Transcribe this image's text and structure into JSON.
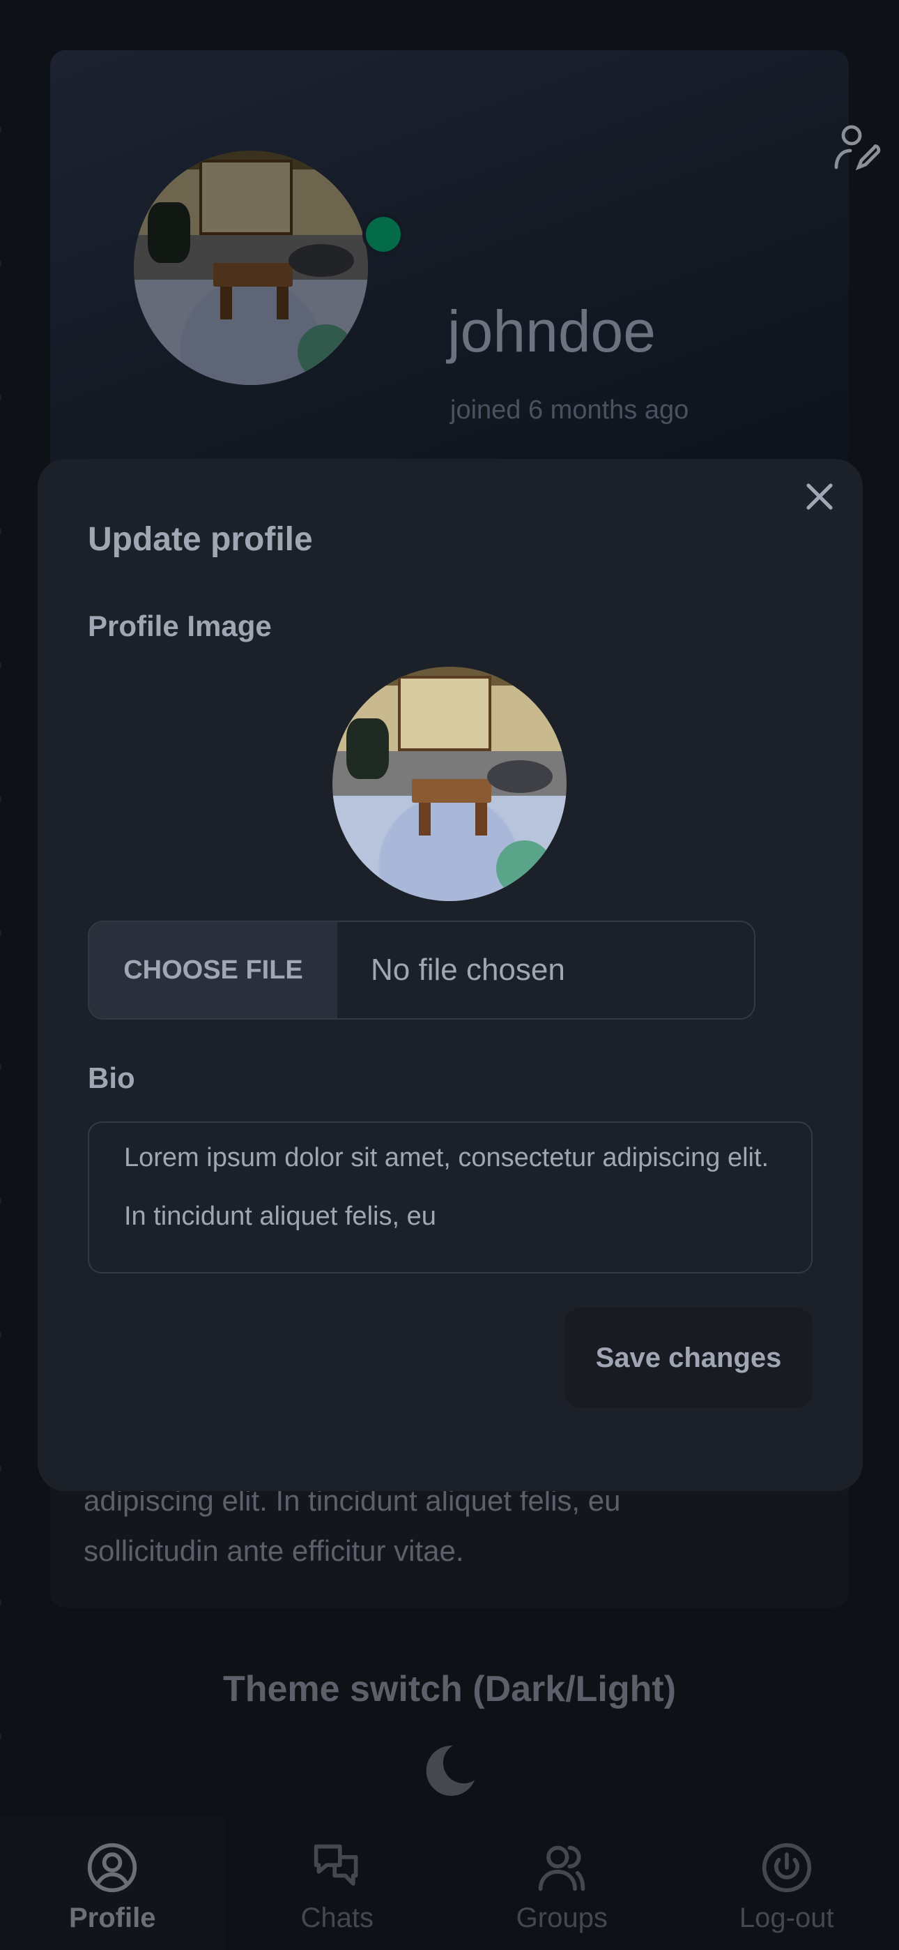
{
  "profile": {
    "username": "johndoe",
    "joined": "joined 6 months ago",
    "status_color": "#036b48",
    "edit_icon": "user-edit-icon",
    "bio_lines": [
      "adipiscing elit. In tincidunt aliquet felis, eu",
      "sollicitudin ante efficitur vitae."
    ]
  },
  "theme": {
    "title": "Theme switch (Dark/Light)",
    "icon": "moon-icon"
  },
  "nav": [
    {
      "label": "Profile",
      "icon": "user-circle-icon",
      "active": true
    },
    {
      "label": "Chats",
      "icon": "chat-bubbles-icon"
    },
    {
      "label": "Groups",
      "icon": "users-icon"
    },
    {
      "label": "Log-out",
      "icon": "power-icon"
    }
  ],
  "modal": {
    "title": "Update profile",
    "image_label": "Profile Image",
    "choose_file": "CHOOSE FILE",
    "file_status": "No file chosen",
    "bio_label": "Bio",
    "bio_value": "Lorem ipsum dolor sit amet, consectetur adipiscing elit. In tincidunt aliquet felis, eu",
    "save_label": "Save changes",
    "close_icon": "close-icon"
  }
}
